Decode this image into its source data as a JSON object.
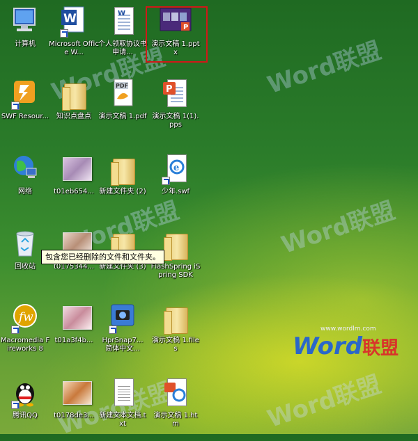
{
  "desktop": {
    "icons": [
      {
        "label": "计算机",
        "icon": "computer-icon"
      },
      {
        "label": "Microsoft Office W...",
        "icon": "word-icon"
      },
      {
        "label": "个人领取协议书申请...",
        "icon": "document-icon"
      },
      {
        "label": "演示文稿 1.pptx",
        "icon": "pptx-thumbnail-icon"
      },
      {
        "label": "SWF Resour...",
        "icon": "swf-resource-icon"
      },
      {
        "label": "知识点盘点",
        "icon": "folder-icon"
      },
      {
        "label": "演示文稿 1.pdf",
        "icon": "pdf-icon"
      },
      {
        "label": "演示文稿 1(1).pps",
        "icon": "pps-icon"
      },
      {
        "label": "网络",
        "icon": "network-icon"
      },
      {
        "label": "t01eb654...",
        "icon": "image-thumbnail-icon"
      },
      {
        "label": "新建文件夹 (2)",
        "icon": "folder-icon"
      },
      {
        "label": "少年.swf",
        "icon": "swf-file-icon"
      },
      {
        "label": "回收站",
        "icon": "recycle-bin-icon"
      },
      {
        "label": "t0175344...",
        "icon": "image-thumbnail-icon"
      },
      {
        "label": "新建文件夹 (3)",
        "icon": "folder-icon"
      },
      {
        "label": "FlashSpring iSpring SDK",
        "icon": "folder-icon"
      },
      {
        "label": "Macromedia Fireworks 8",
        "icon": "fireworks-icon"
      },
      {
        "label": "t01a3f4b...",
        "icon": "image-thumbnail-icon"
      },
      {
        "label": "HprSnap7... 简体中文...",
        "icon": "hypersnap-icon"
      },
      {
        "label": "演示文稿 1.files",
        "icon": "folder-icon"
      },
      {
        "label": "腾讯QQ",
        "icon": "qq-icon"
      },
      {
        "label": "t0178de3...",
        "icon": "image-thumbnail-icon"
      },
      {
        "label": "新建文本文档.txt",
        "icon": "text-file-icon"
      },
      {
        "label": "演示文稿 1.htm",
        "icon": "html-file-icon"
      }
    ],
    "tooltip": "包含您已经删除的文件和文件夹。"
  },
  "watermark": {
    "brand": "Word",
    "brand_cn": "联盟",
    "site": "www.wordlm.com"
  }
}
